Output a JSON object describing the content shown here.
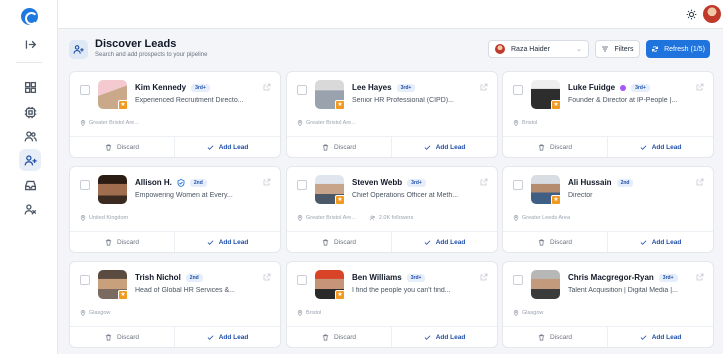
{
  "sidebar": {
    "items": [
      {
        "icon": "collapse-icon"
      },
      {
        "icon": "dashboard-icon"
      },
      {
        "icon": "chip-icon"
      },
      {
        "icon": "users-icon"
      },
      {
        "icon": "add-user-icon"
      },
      {
        "icon": "inbox-icon"
      },
      {
        "icon": "user-minus-icon"
      }
    ]
  },
  "header": {
    "title": "Discover Leads",
    "subtitle": "Search and add prospects to your pipeline",
    "user_select": "Raza Haider",
    "filters_label": "Filters",
    "refresh_label": "Refresh (1/5)"
  },
  "card_labels": {
    "discard": "Discard",
    "add": "Add Lead"
  },
  "colors": {
    "accent": "#1f73dc",
    "badge_star": "#f29a1f"
  },
  "leads": [
    {
      "name": "Kim Kennedy",
      "degree": "3rd+",
      "headline": "Experienced Recruitment Directo...",
      "location": "Greater Bristol Are...",
      "followers": ""
    },
    {
      "name": "Lee Hayes",
      "degree": "3rd+",
      "headline": "Senior HR Professional (CIPD)...",
      "location": "Greater Bristol Are...",
      "followers": ""
    },
    {
      "name": "Luke Fuidge",
      "degree": "3rd+",
      "headline": "Founder & Director at IP-People |...",
      "location": "Bristol",
      "followers": ""
    },
    {
      "name": "Allison H.",
      "degree": "2nd",
      "headline": "Empowering Women at Every...",
      "location": "United Kingdom",
      "followers": ""
    },
    {
      "name": "Steven Webb",
      "degree": "3rd+",
      "headline": "Chief Operations Officer at Meth...",
      "location": "Greater Bristol Are...",
      "followers": "2.0K followers"
    },
    {
      "name": "Ali Hussain",
      "degree": "2nd",
      "headline": "Director",
      "location": "Greater Leeds Area",
      "followers": ""
    },
    {
      "name": "Trish Nichol",
      "degree": "2nd",
      "headline": "Head of Global HR Services &...",
      "location": "Glasgow",
      "followers": ""
    },
    {
      "name": "Ben Williams",
      "degree": "3rd+",
      "headline": "I find the people you can't find...",
      "location": "Bristol",
      "followers": ""
    },
    {
      "name": "Chris Macgregor-Ryan",
      "degree": "3rd+",
      "headline": "Talent Acquisition | Digital Media |...",
      "location": "Glasgow",
      "followers": ""
    }
  ]
}
